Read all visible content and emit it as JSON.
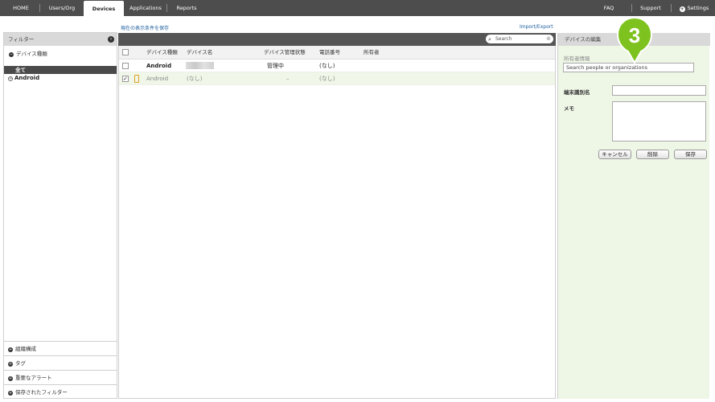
{
  "nav": {
    "tabs": [
      "HOME",
      "Users/Org",
      "Devices",
      "Applications",
      "Reports"
    ],
    "right": [
      "FAQ",
      "Support",
      "Settings"
    ]
  },
  "links": {
    "save_view": "現在の表示条件を保存",
    "import_export": "Import/Export"
  },
  "sidebar": {
    "header": "フィルター",
    "collapse_icon": "‹",
    "device_type_label": "デバイス種類",
    "all_label": "全て",
    "android_label": "Android",
    "bottom_sections": [
      "組織構成",
      "タグ",
      "重要なアラート",
      "保存されたフィルター"
    ]
  },
  "grid": {
    "search_placeholder": "Search",
    "headers": [
      "デバイス種類",
      "デバイス名",
      "デバイス管理状態",
      "電話番号",
      "所有者"
    ],
    "rows": [
      {
        "type": "Android",
        "status": "管理中",
        "phone": "(なし)",
        "checked": false
      },
      {
        "type": "Android",
        "name": "(なし)",
        "status": "–",
        "phone": "(なし)",
        "checked": true
      }
    ]
  },
  "panel": {
    "title": "デバイスの編集",
    "owner_label": "所有者情報",
    "owner_placeholder": "Search people or organizations",
    "device_id_label": "端末識別名",
    "memo_label": "メモ",
    "buttons": [
      "キャンセル",
      "削除",
      "保存"
    ]
  },
  "marker": {
    "number": "3",
    "color": "#7dc21e"
  }
}
